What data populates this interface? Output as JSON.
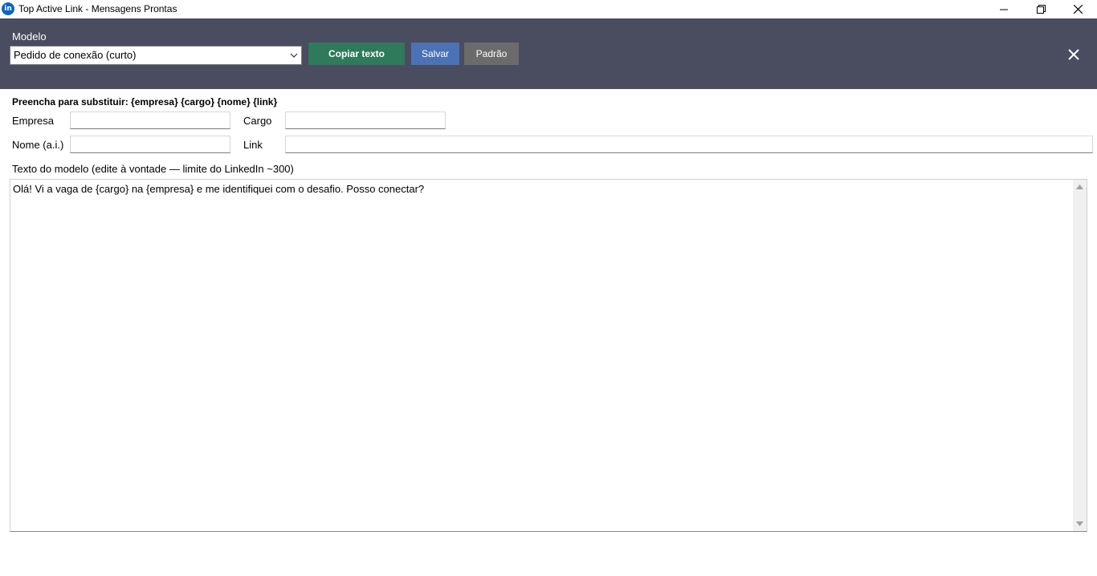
{
  "window": {
    "title": "Top Active Link - Mensagens Prontas",
    "icon": "in"
  },
  "header": {
    "modelo_label": "Modelo",
    "modelo_selected": "Pedido de conexão (curto)",
    "copy_label": "Copiar texto",
    "save_label": "Salvar",
    "default_label": "Padrão",
    "colors": {
      "band": "#4a4c60",
      "copy": "#2e7a5b",
      "save": "#4a72b4",
      "default": "#6b6b6b"
    }
  },
  "form": {
    "hint": "Preencha para substituir: {empresa} {cargo} {nome} {link}",
    "empresa_label": "Empresa",
    "empresa_value": "",
    "cargo_label": "Cargo",
    "cargo_value": "",
    "nome_label": "Nome (a.i.)",
    "nome_value": "",
    "link_label": "Link",
    "link_value": ""
  },
  "template": {
    "label": "Texto do modelo (edite à vontade — limite do LinkedIn ~300)",
    "text": "Olá! Vi a vaga de {cargo} na {empresa} e me identifiquei com o desafio. Posso conectar?"
  }
}
